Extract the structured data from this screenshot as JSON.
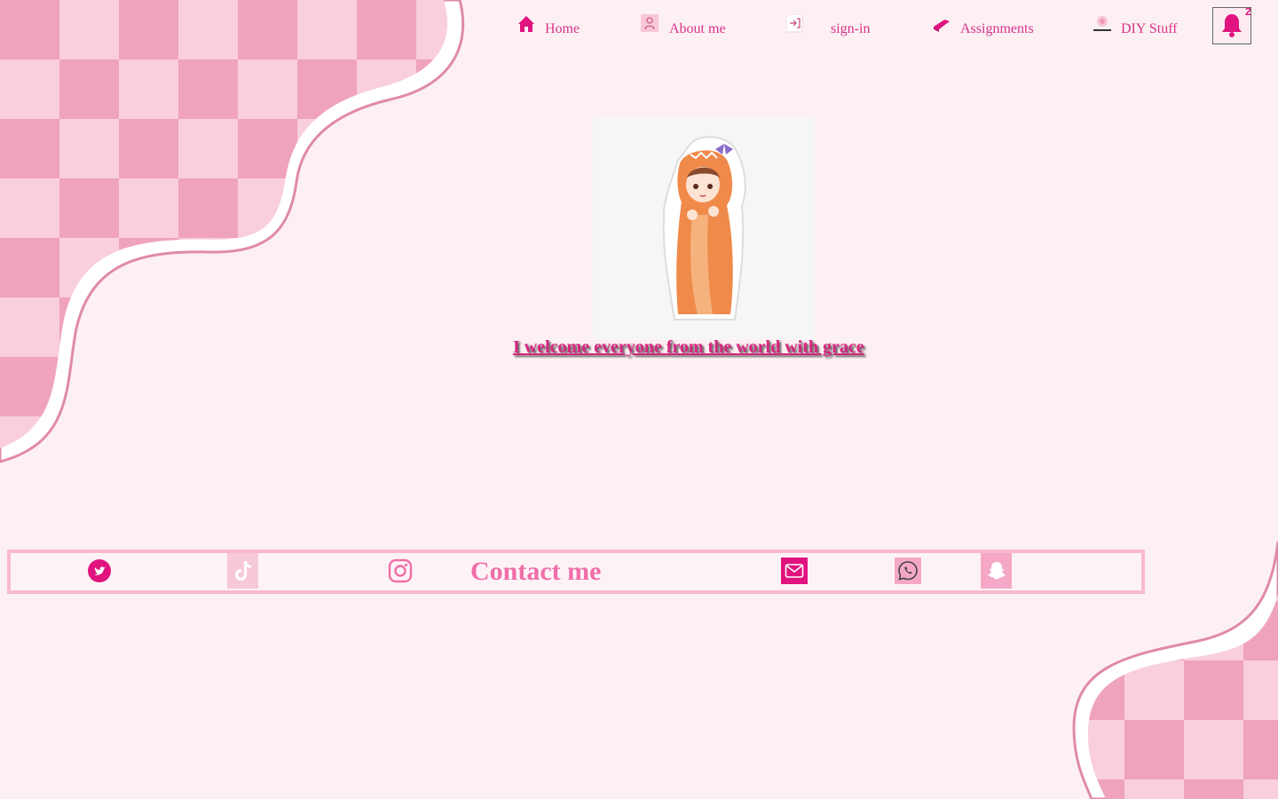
{
  "nav": {
    "items": [
      {
        "label": "Home",
        "icon": "home-icon"
      },
      {
        "label": "About me",
        "icon": "person-icon"
      },
      {
        "label": "sign-in",
        "icon": "sign-in-icon"
      },
      {
        "label": "Assignments",
        "icon": "book-icon"
      },
      {
        "label": "DIY Stuff",
        "icon": "craft-icon"
      }
    ],
    "notifications": {
      "icon": "bell-icon",
      "count": "2"
    }
  },
  "hero": {
    "image": "anime-girl-dino-hoodie",
    "welcome_text": "I welcome everyone from the world with grace"
  },
  "contact": {
    "title": "Contact me",
    "socials": [
      "twitter-icon",
      "tiktok-icon",
      "instagram-icon",
      "email-icon",
      "whatsapp-icon",
      "snapchat-icon"
    ]
  },
  "colors": {
    "accent": "#d6338a",
    "background": "#fdf0f3",
    "checker_dark": "#efa3bc",
    "checker_light": "#f9cfdb",
    "contact_border": "#f8b9cd"
  }
}
